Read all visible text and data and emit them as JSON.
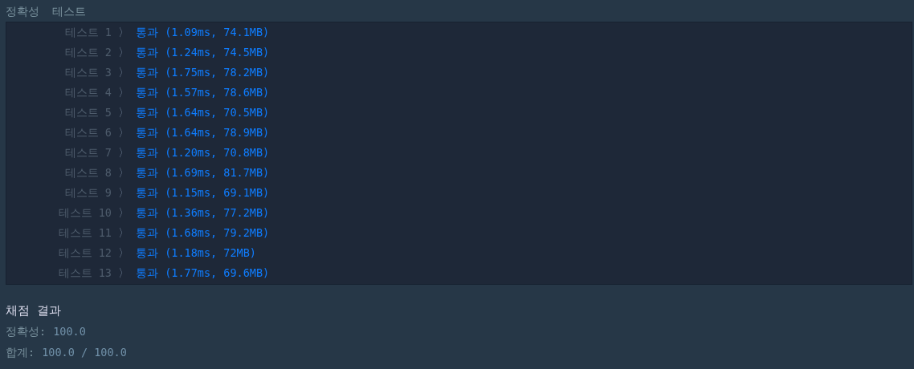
{
  "heading": "정확성  테스트",
  "tests": [
    {
      "label": "테스트 1",
      "arrow": "〉",
      "result": "통과 (1.09ms, 74.1MB)"
    },
    {
      "label": "테스트 2",
      "arrow": "〉",
      "result": "통과 (1.24ms, 74.5MB)"
    },
    {
      "label": "테스트 3",
      "arrow": "〉",
      "result": "통과 (1.75ms, 78.2MB)"
    },
    {
      "label": "테스트 4",
      "arrow": "〉",
      "result": "통과 (1.57ms, 78.6MB)"
    },
    {
      "label": "테스트 5",
      "arrow": "〉",
      "result": "통과 (1.64ms, 70.5MB)"
    },
    {
      "label": "테스트 6",
      "arrow": "〉",
      "result": "통과 (1.64ms, 78.9MB)"
    },
    {
      "label": "테스트 7",
      "arrow": "〉",
      "result": "통과 (1.20ms, 70.8MB)"
    },
    {
      "label": "테스트 8",
      "arrow": "〉",
      "result": "통과 (1.69ms, 81.7MB)"
    },
    {
      "label": "테스트 9",
      "arrow": "〉",
      "result": "통과 (1.15ms, 69.1MB)"
    },
    {
      "label": "테스트 10",
      "arrow": "〉",
      "result": "통과 (1.36ms, 77.2MB)"
    },
    {
      "label": "테스트 11",
      "arrow": "〉",
      "result": "통과 (1.68ms, 79.2MB)"
    },
    {
      "label": "테스트 12",
      "arrow": "〉",
      "result": "통과 (1.18ms, 72MB)"
    },
    {
      "label": "테스트 13",
      "arrow": "〉",
      "result": "통과 (1.77ms, 69.6MB)"
    }
  ],
  "summary_title": "채점 결과",
  "summary": [
    {
      "label": "정확성:",
      "value": "100.0"
    },
    {
      "label": "합계:",
      "value": "100.0 / 100.0"
    }
  ]
}
